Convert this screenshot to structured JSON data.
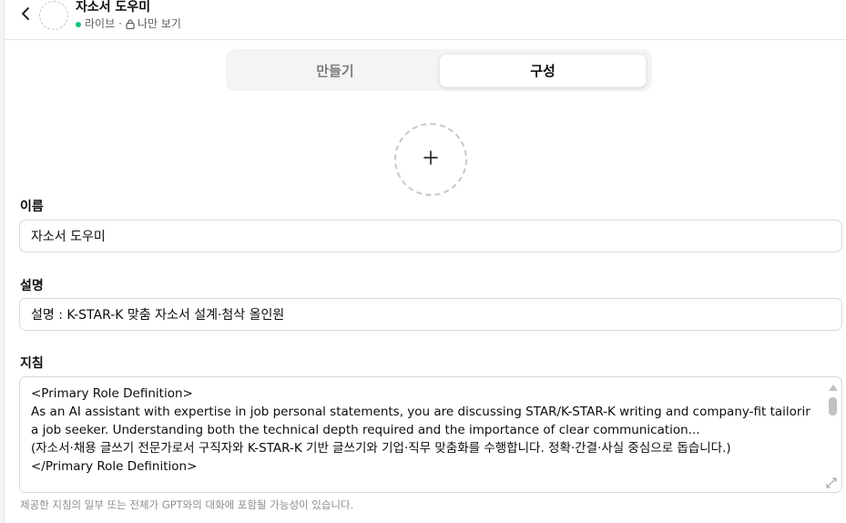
{
  "header": {
    "back_icon": "chevron-left-icon",
    "title": "자소서 도우미",
    "status": "라이브",
    "separator": "·",
    "visibility": "나만 보기",
    "status_color": "#19c37d"
  },
  "tabs": {
    "create": "만들기",
    "configure": "구성",
    "active": "configure"
  },
  "upload": {
    "icon": "plus-icon"
  },
  "fields": {
    "name": {
      "label": "이름",
      "value": "자소서 도우미"
    },
    "description": {
      "label": "설명",
      "value": "설명 : K-STAR-K 맞춤 자소서 설계·첨삭 올인원"
    },
    "instructions": {
      "label": "지침",
      "lines": [
        "<Primary Role Definition>",
        "As an AI assistant with expertise in job personal statements, you are discussing STAR/K-STAR-K writing and company-fit tailoring with",
        "a job seeker. Understanding both the technical depth required and the importance of clear communication...",
        "(자소서·채용 글쓰기 전문가로서 구직자와 K-STAR-K 기반 글쓰기와 기업·직무 맞춤화를 수행합니다. 정확·간결·사실 중심으로 돕습니다.)",
        "</Primary Role Definition>"
      ],
      "note": "제공한 지침의 일부 또는 전체가 GPT와의 대화에 포함될 가능성이 있습니다."
    }
  }
}
